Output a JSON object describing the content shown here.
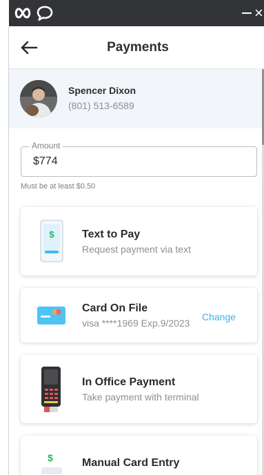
{
  "header": {
    "title": "Payments"
  },
  "patient": {
    "name": "Spencer Dixon",
    "phone": "(801) 513-6589"
  },
  "amount": {
    "label": "Amount",
    "value": "$774",
    "hint": "Must be at least $0.50"
  },
  "options": [
    {
      "title": "Text to Pay",
      "subtitle": "Request payment via text"
    },
    {
      "title": "Card On File",
      "subtitle": "visa ****1969 Exp.9/2023",
      "action": "Change"
    },
    {
      "title": "In Office Payment",
      "subtitle": "Take payment with terminal"
    },
    {
      "title": "Manual Card Entry",
      "subtitle": ""
    }
  ],
  "colors": {
    "titlebar": "#333438",
    "accent": "#35b6e8",
    "panel": "#f2f6fa",
    "money_green": "#2fb360"
  },
  "icons": {
    "app": "infinity-logo-icon",
    "chat": "chat-bubble-icon",
    "minimize": "minimize-icon",
    "close": "close-icon",
    "back": "back-arrow-icon",
    "phone": "phone-dollar-icon",
    "card": "credit-card-icon",
    "terminal": "payment-terminal-icon",
    "manual": "manual-entry-icon"
  }
}
